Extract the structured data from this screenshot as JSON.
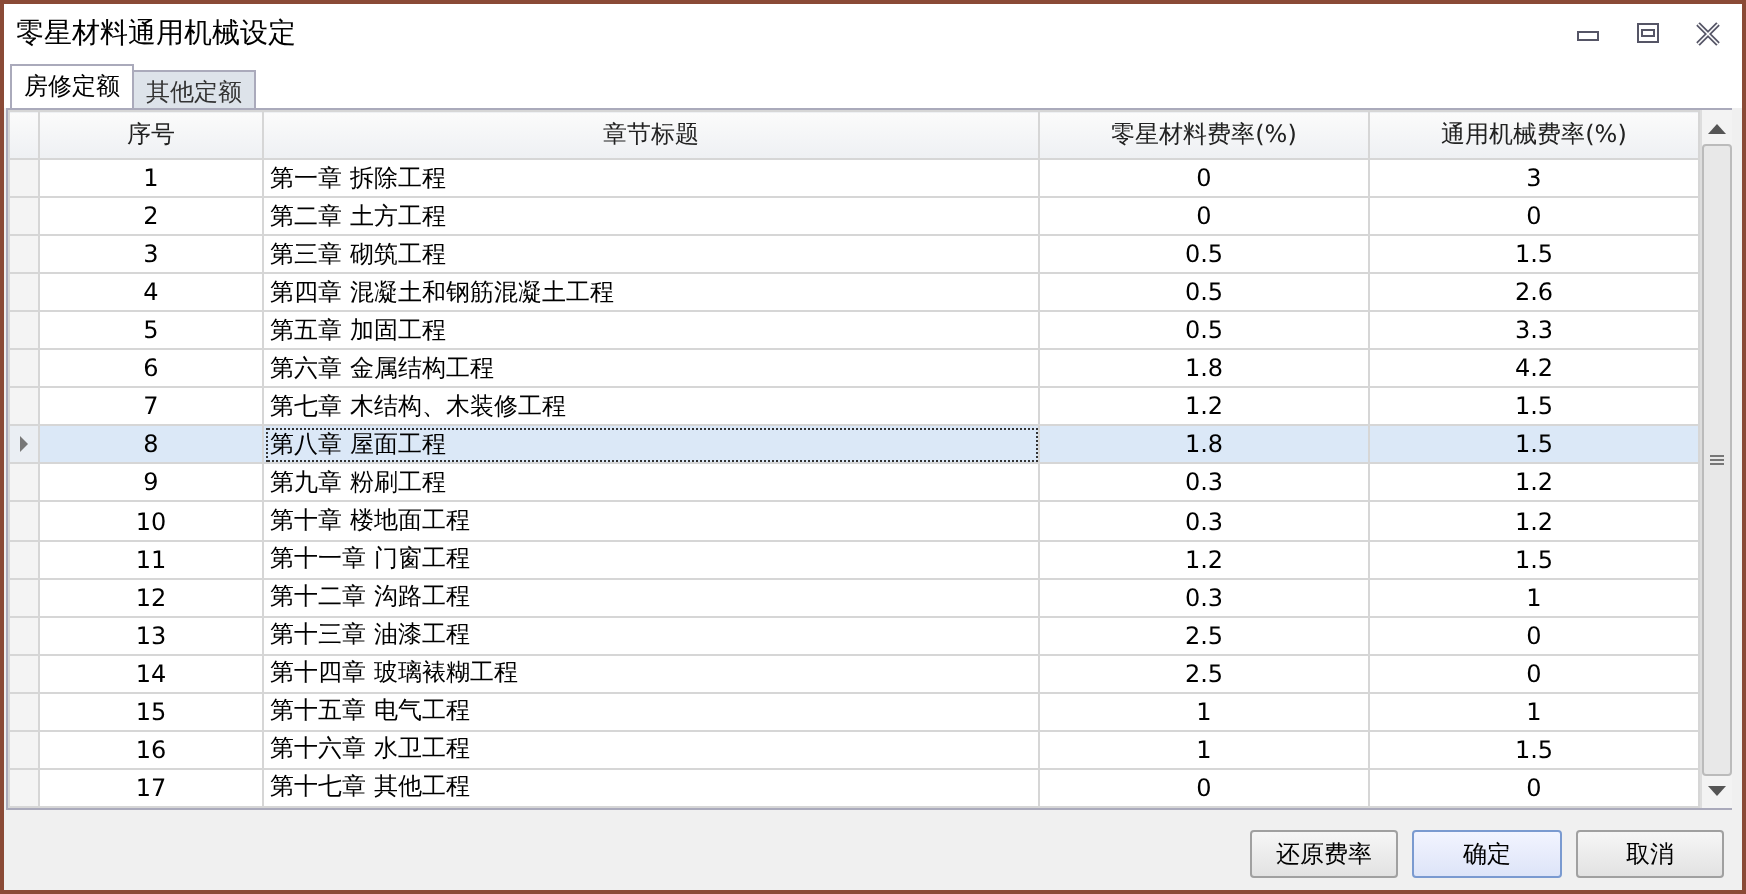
{
  "window": {
    "title": "零星材料通用机械设定"
  },
  "tabs": [
    {
      "label": "房修定额",
      "selected": true
    },
    {
      "label": "其他定额",
      "selected": false
    }
  ],
  "table": {
    "columns": [
      "序号",
      "章节标题",
      "零星材料费率(%)",
      "通用机械费率(%)"
    ],
    "rows": [
      {
        "cells": [
          "1",
          "第一章 拆除工程",
          "0",
          "3"
        ],
        "selected": false
      },
      {
        "cells": [
          "2",
          "第二章 土方工程",
          "0",
          "0"
        ],
        "selected": false
      },
      {
        "cells": [
          "3",
          "第三章 砌筑工程",
          "0.5",
          "1.5"
        ],
        "selected": false
      },
      {
        "cells": [
          "4",
          "第四章 混凝土和钢筋混凝土工程",
          "0.5",
          "2.6"
        ],
        "selected": false
      },
      {
        "cells": [
          "5",
          "第五章 加固工程",
          "0.5",
          "3.3"
        ],
        "selected": false
      },
      {
        "cells": [
          "6",
          "第六章 金属结构工程",
          "1.8",
          "4.2"
        ],
        "selected": false
      },
      {
        "cells": [
          "7",
          "第七章 木结构、木装修工程",
          "1.2",
          "1.5"
        ],
        "selected": false
      },
      {
        "cells": [
          "8",
          "第八章 屋面工程",
          "1.8",
          "1.5"
        ],
        "selected": true
      },
      {
        "cells": [
          "9",
          "第九章 粉刷工程",
          "0.3",
          "1.2"
        ],
        "selected": false
      },
      {
        "cells": [
          "10",
          "第十章 楼地面工程",
          "0.3",
          "1.2"
        ],
        "selected": false
      },
      {
        "cells": [
          "11",
          "第十一章 门窗工程",
          "1.2",
          "1.5"
        ],
        "selected": false
      },
      {
        "cells": [
          "12",
          "第十二章 沟路工程",
          "0.3",
          "1"
        ],
        "selected": false
      },
      {
        "cells": [
          "13",
          "第十三章 油漆工程",
          "2.5",
          "0"
        ],
        "selected": false
      },
      {
        "cells": [
          "14",
          "第十四章 玻璃裱糊工程",
          "2.5",
          "0"
        ],
        "selected": false
      },
      {
        "cells": [
          "15",
          "第十五章 电气工程",
          "1",
          "1"
        ],
        "selected": false
      },
      {
        "cells": [
          "16",
          "第十六章 水卫工程",
          "1",
          "1.5"
        ],
        "selected": false
      },
      {
        "cells": [
          "17",
          "第十七章 其他工程",
          "0",
          "0"
        ],
        "selected": false
      }
    ]
  },
  "buttons": [
    "还原费率",
    "确定",
    "取消"
  ]
}
